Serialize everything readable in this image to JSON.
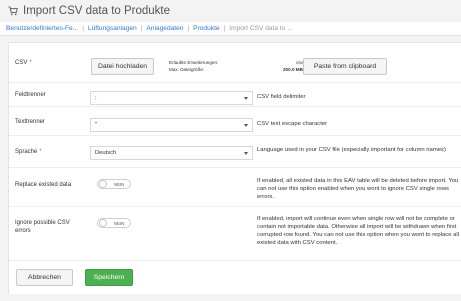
{
  "page": {
    "title": "Import CSV data to Produkte",
    "cart_icon": "shopping-cart-icon"
  },
  "breadcrumb": {
    "items": [
      "Benutzerdefiniertes-Fe...",
      "Lüftungsanlagen",
      "Anlagedaten",
      "Produkte"
    ],
    "current": "Import CSV data to ..."
  },
  "form": {
    "csv": {
      "label": "CSV",
      "upload_button": "Datei hochladen",
      "allowed_ext_label": "Erlaubte Erweiterungen:",
      "allowed_ext_value": "csv",
      "max_size_label": "Max. Dateigröße:",
      "max_size_value": "200.0 MB",
      "paste_button": "Paste from clipboard"
    },
    "field_delimiter": {
      "label": "Feldtrenner",
      "value": ";",
      "description": "CSV field delimiter"
    },
    "text_delimiter": {
      "label": "Texttrenner",
      "value": "\"",
      "description": "CSV text escape character"
    },
    "language": {
      "label": "Sprache",
      "value": "Deutsch",
      "description": "Language used in your CSV file (especially important for column names)"
    },
    "replace_existing": {
      "label": "Replace existed data",
      "toggle_text": "NEIN",
      "description": "If enabled, all existed data in this EAV table will be deleted before import. You can not use this option enabled when you wont to ignore CSV single rows errors."
    },
    "ignore_errors": {
      "label": "Ignore possible CSV errors",
      "toggle_text": "NEIN",
      "description": "If enabled, import will continue even when single row will not be complete or contain not importable data. Otherwise all import will be withdrawn when first corrupted row found. You can not use this option when you wont to replace all existed data with CSV content."
    }
  },
  "footer": {
    "cancel_label": "Abbrechen",
    "save_label": "Speichern"
  },
  "colors": {
    "link": "#2f7ad7",
    "save_button": "#4caf50",
    "required": "#d9534f"
  }
}
